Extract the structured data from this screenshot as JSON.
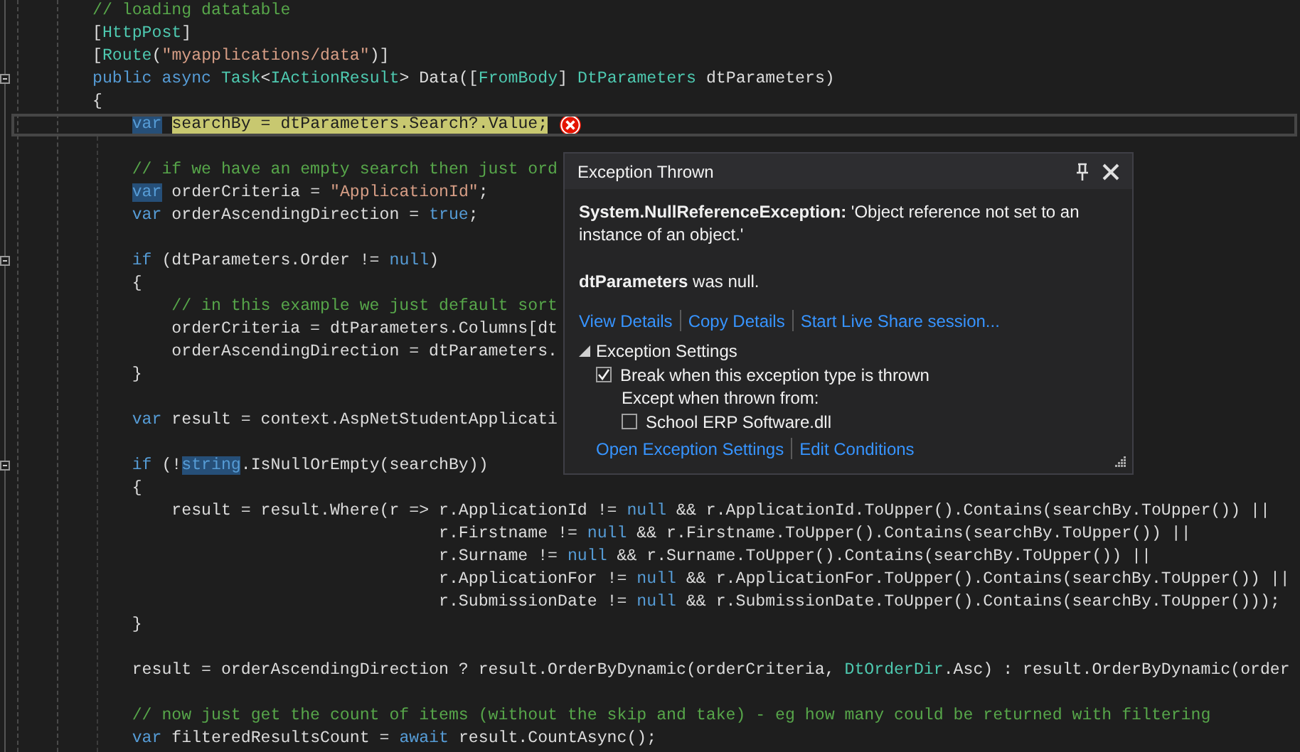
{
  "editor": {
    "lines": [
      {
        "kind": "code",
        "tokens": [
          {
            "text": "// loading datatable",
            "kind": "comment"
          }
        ]
      },
      {
        "kind": "code",
        "tokens": [
          {
            "text": "[",
            "kind": "plain"
          },
          {
            "text": "HttpPost",
            "kind": "type"
          },
          {
            "text": "]",
            "kind": "plain"
          }
        ]
      },
      {
        "kind": "code",
        "tokens": [
          {
            "text": "[",
            "kind": "plain"
          },
          {
            "text": "Route",
            "kind": "type"
          },
          {
            "text": "(",
            "kind": "plain"
          },
          {
            "text": "\"myapplications/data\"",
            "kind": "string"
          },
          {
            "text": ")]",
            "kind": "plain"
          }
        ]
      },
      {
        "kind": "code",
        "expanded": true,
        "tokens": [
          {
            "text": "public async",
            "kind": "keyword"
          },
          {
            "text": " Task",
            "kind": "type"
          },
          {
            "text": "<",
            "kind": "plain"
          },
          {
            "text": "IActionResult",
            "kind": "type"
          },
          {
            "text": "> Data([",
            "kind": "plain"
          },
          {
            "text": "FromBody",
            "kind": "type"
          },
          {
            "text": "] ",
            "kind": "plain"
          },
          {
            "text": "DtParameters",
            "kind": "type"
          },
          {
            "text": " dtParameters)",
            "kind": "plain"
          }
        ]
      },
      {
        "kind": "code",
        "tokens": [
          {
            "text": "{",
            "kind": "plain"
          }
        ]
      },
      {
        "kind": "current",
        "tokens": [
          {
            "text": "    var",
            "kind": "keyword",
            "selected": true
          },
          {
            "text": " searchBy = dtParameters.Search?.Value;",
            "kind": "plain",
            "current_statement": true
          }
        ]
      },
      {
        "kind": "blank"
      },
      {
        "kind": "code",
        "tokens": [
          {
            "text": "    // if we have an empty search then just ord",
            "kind": "comment"
          }
        ]
      },
      {
        "kind": "code",
        "tokens": [
          {
            "text": "    var",
            "kind": "keyword",
            "selected": true
          },
          {
            "text": " orderCriteria = ",
            "kind": "plain"
          },
          {
            "text": "\"ApplicationId\"",
            "kind": "string"
          },
          {
            "text": ";",
            "kind": "plain"
          }
        ]
      },
      {
        "kind": "code",
        "tokens": [
          {
            "text": "    var",
            "kind": "keyword"
          },
          {
            "text": " orderAscendingDirection = ",
            "kind": "plain"
          },
          {
            "text": "true",
            "kind": "keyword"
          },
          {
            "text": ";",
            "kind": "plain"
          }
        ]
      },
      {
        "kind": "blank"
      },
      {
        "kind": "code",
        "expanded": true,
        "tokens": [
          {
            "text": "    if",
            "kind": "keyword"
          },
          {
            "text": " (dtParameters.Order != ",
            "kind": "plain"
          },
          {
            "text": "null",
            "kind": "keyword"
          },
          {
            "text": ")",
            "kind": "plain"
          }
        ]
      },
      {
        "kind": "code",
        "tokens": [
          {
            "text": "    {",
            "kind": "plain"
          }
        ]
      },
      {
        "kind": "code",
        "tokens": [
          {
            "text": "        // in this example we just default sort",
            "kind": "comment"
          }
        ]
      },
      {
        "kind": "code",
        "tokens": [
          {
            "text": "        orderCriteria = dtParameters.Columns[dt",
            "kind": "plain"
          }
        ]
      },
      {
        "kind": "code",
        "tokens": [
          {
            "text": "        orderAscendingDirection = dtParameters.",
            "kind": "plain"
          }
        ]
      },
      {
        "kind": "code",
        "tokens": [
          {
            "text": "    }",
            "kind": "plain"
          }
        ]
      },
      {
        "kind": "blank"
      },
      {
        "kind": "code",
        "tokens": [
          {
            "text": "    var",
            "kind": "keyword"
          },
          {
            "text": " result = context.AspNetStudentApplicati",
            "kind": "plain"
          }
        ]
      },
      {
        "kind": "blank"
      },
      {
        "kind": "code",
        "expanded": true,
        "tokens": [
          {
            "text": "    if",
            "kind": "keyword"
          },
          {
            "text": " (!",
            "kind": "plain"
          },
          {
            "text": "string",
            "kind": "keyword",
            "selected": true
          },
          {
            "text": ".IsNullOrEmpty(searchBy))",
            "kind": "plain"
          }
        ]
      },
      {
        "kind": "code",
        "tokens": [
          {
            "text": "    {",
            "kind": "plain"
          }
        ]
      },
      {
        "kind": "code",
        "tokens": [
          {
            "text": "        result = result.Where(r => r.ApplicationId != ",
            "kind": "plain"
          },
          {
            "text": "null",
            "kind": "keyword"
          },
          {
            "text": " && r.ApplicationId.ToUpper().Contains(searchBy.ToUpper()) ||",
            "kind": "plain"
          }
        ]
      },
      {
        "kind": "code",
        "tokens": [
          {
            "text": "                                   r.Firstname != ",
            "kind": "plain"
          },
          {
            "text": "null",
            "kind": "keyword"
          },
          {
            "text": " && r.Firstname.ToUpper().Contains(searchBy.ToUpper()) ||",
            "kind": "plain"
          }
        ]
      },
      {
        "kind": "code",
        "tokens": [
          {
            "text": "                                   r.Surname != ",
            "kind": "plain"
          },
          {
            "text": "null",
            "kind": "keyword"
          },
          {
            "text": " && r.Surname.ToUpper().Contains(searchBy.ToUpper()) ||",
            "kind": "plain"
          }
        ]
      },
      {
        "kind": "code",
        "tokens": [
          {
            "text": "                                   r.ApplicationFor != ",
            "kind": "plain"
          },
          {
            "text": "null",
            "kind": "keyword"
          },
          {
            "text": " && r.ApplicationFor.ToUpper().Contains(searchBy.ToUpper()) ||",
            "kind": "plain"
          }
        ]
      },
      {
        "kind": "code",
        "tokens": [
          {
            "text": "                                   r.SubmissionDate != ",
            "kind": "plain"
          },
          {
            "text": "null",
            "kind": "keyword"
          },
          {
            "text": " && r.SubmissionDate.ToUpper().Contains(searchBy.ToUpper()));",
            "kind": "plain"
          }
        ]
      },
      {
        "kind": "code",
        "tokens": [
          {
            "text": "    }",
            "kind": "plain"
          }
        ]
      },
      {
        "kind": "blank"
      },
      {
        "kind": "code",
        "tokens": [
          {
            "text": "    result = orderAscendingDirection ? result.OrderByDynamic(orderCriteria, ",
            "kind": "plain"
          },
          {
            "text": "DtOrderDir",
            "kind": "type"
          },
          {
            "text": ".Asc) : result.OrderByDynamic(order",
            "kind": "plain"
          }
        ]
      },
      {
        "kind": "blank"
      },
      {
        "kind": "code",
        "tokens": [
          {
            "text": "    // now just get the count of items (without the skip and take) - eg how many could be returned with filtering",
            "kind": "comment"
          }
        ]
      },
      {
        "kind": "code",
        "tokens": [
          {
            "text": "    var",
            "kind": "keyword"
          },
          {
            "text": " filteredResultsCount = ",
            "kind": "plain"
          },
          {
            "text": "await",
            "kind": "keyword"
          },
          {
            "text": " result.CountAsync();",
            "kind": "plain"
          }
        ]
      }
    ]
  },
  "exception_popup": {
    "title": "Exception Thrown",
    "message": "**System.NullReferenceException:** 'Object reference not set to an instance of an object.'",
    "detail": "**dtParameters** was null.",
    "links": [
      "View Details",
      "Copy Details",
      "Start Live Share session..."
    ],
    "settings": {
      "title": "Exception Settings",
      "expanded": true,
      "break_option": {
        "label": "Break when this exception type is thrown",
        "checked": true
      },
      "except_label": "Except when thrown from:",
      "modules": [
        {
          "label": "School ERP Software.dll",
          "checked": false
        }
      ],
      "links": [
        "Open Exception Settings",
        "Edit Conditions"
      ]
    }
  }
}
